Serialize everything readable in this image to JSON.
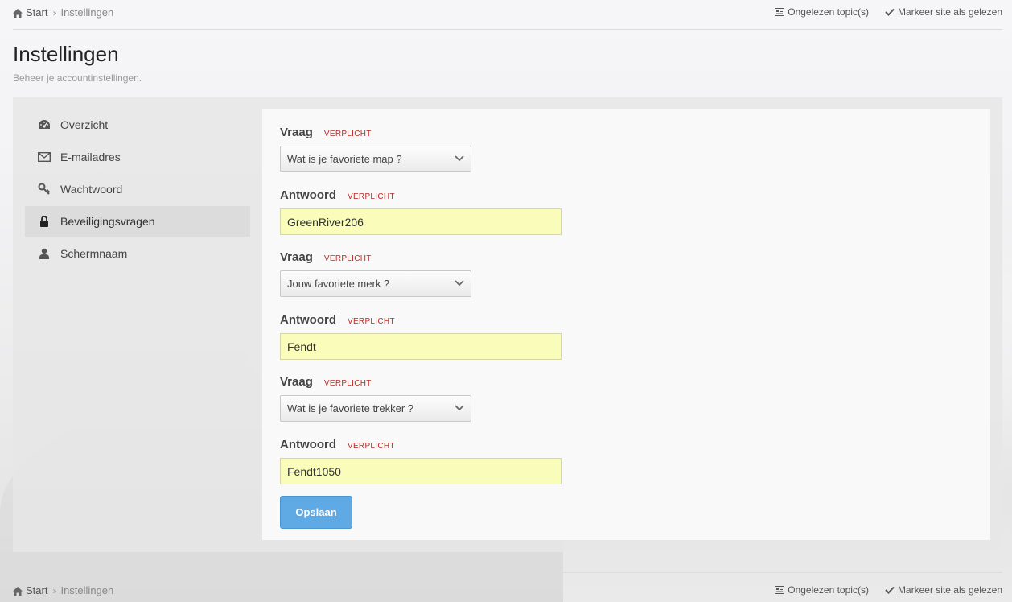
{
  "breadcrumb": {
    "home": "Start",
    "current": "Instellingen"
  },
  "toplinks": {
    "unread": "Ongelezen topic(s)",
    "mark_read": "Markeer site als gelezen"
  },
  "page": {
    "title": "Instellingen",
    "subtitle": "Beheer je accountinstellingen."
  },
  "sidebar": {
    "items": [
      {
        "label": "Overzicht",
        "icon": "dashboard-icon"
      },
      {
        "label": "E-mailadres",
        "icon": "envelope-icon"
      },
      {
        "label": "Wachtwoord",
        "icon": "key-icon"
      },
      {
        "label": "Beveiligingsvragen",
        "icon": "lock-icon",
        "active": true
      },
      {
        "label": "Schermnaam",
        "icon": "user-icon"
      }
    ]
  },
  "form": {
    "question_label": "Vraag",
    "answer_label": "Antwoord",
    "required": "VERPLICHT",
    "questions": [
      {
        "question": "Wat is je favoriete map ?",
        "answer": "GreenRiver206"
      },
      {
        "question": "Jouw favoriete merk ?",
        "answer": "Fendt"
      },
      {
        "question": "Wat is je favoriete trekker ?",
        "answer": "Fendt1050"
      }
    ],
    "save_label": "Opslaan"
  },
  "colors": {
    "accent": "#5fa9e5",
    "required": "#b92c28",
    "answer_bg": "#fafdba"
  }
}
